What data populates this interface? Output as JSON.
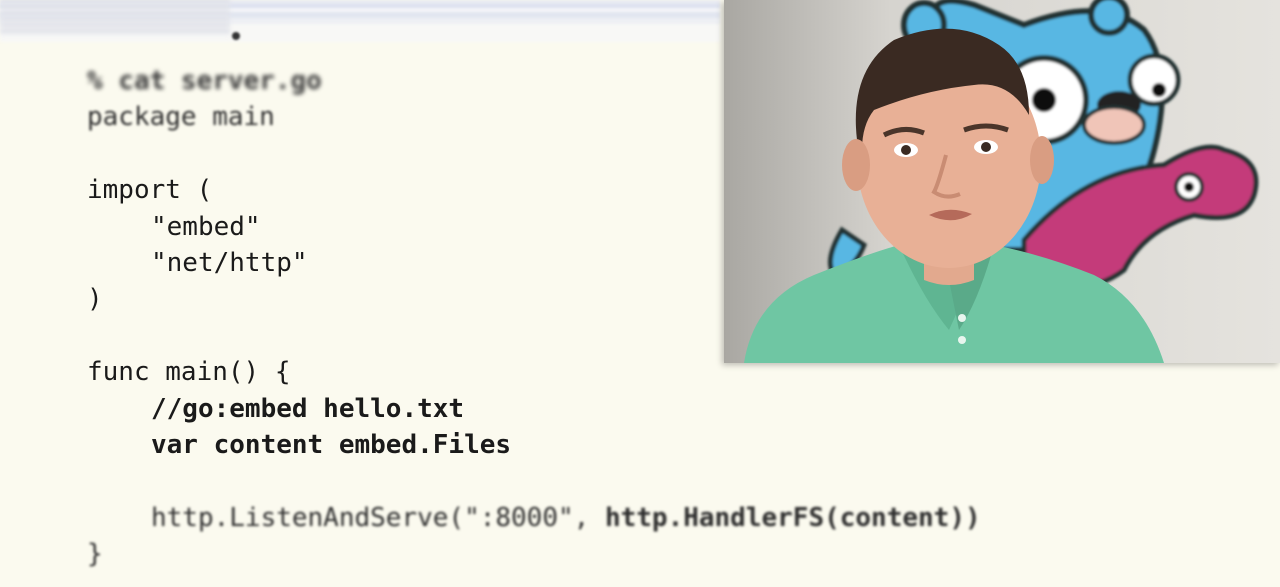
{
  "code": {
    "lines": [
      "% cat server.go",
      "package main",
      "",
      "import (",
      "\"embed\"",
      "\"net/http\"",
      ")",
      "",
      "func main() {",
      "//go:embed hello.txt",
      "var content embed.Files",
      "",
      "http.ListenAndServe(\":8000\", ",
      "http.HandlerFS(content))",
      "}"
    ]
  },
  "video": {
    "accessible_description": "presenter webcam with gopher mascot"
  },
  "colors": {
    "background": "#fbfaef",
    "text": "#1a1a1a",
    "shirt": "#6fc6a3",
    "gopher_blue": "#58b7e3",
    "gopher_pink": "#c43a7a"
  }
}
